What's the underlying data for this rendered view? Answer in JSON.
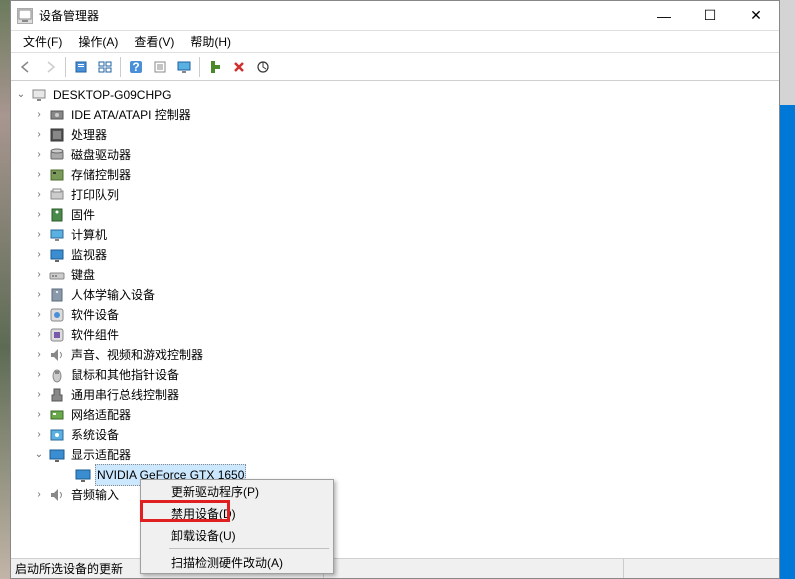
{
  "window": {
    "title": "设备管理器",
    "controls": {
      "min": "—",
      "max": "☐",
      "close": "✕"
    }
  },
  "menubar": {
    "file": "文件(F)",
    "action": "操作(A)",
    "view": "查看(V)",
    "help": "帮助(H)"
  },
  "tree": {
    "root": "DESKTOP-G09CHPG",
    "items": [
      "IDE ATA/ATAPI 控制器",
      "处理器",
      "磁盘驱动器",
      "存储控制器",
      "打印队列",
      "固件",
      "计算机",
      "监视器",
      "键盘",
      "人体学输入设备",
      "软件设备",
      "软件组件",
      "声音、视频和游戏控制器",
      "鼠标和其他指针设备",
      "通用串行总线控制器",
      "网络适配器",
      "系统设备"
    ],
    "display_adapters": "显示适配器",
    "gpu": "NVIDIA GeForce GTX 1650",
    "audio_partial": "音频输入"
  },
  "context_menu": {
    "update": "更新驱动程序(P)",
    "disable": "禁用设备(D)",
    "uninstall": "卸载设备(U)",
    "scan": "扫描检测硬件改动(A)"
  },
  "statusbar": {
    "text": "启动所选设备的更新"
  }
}
